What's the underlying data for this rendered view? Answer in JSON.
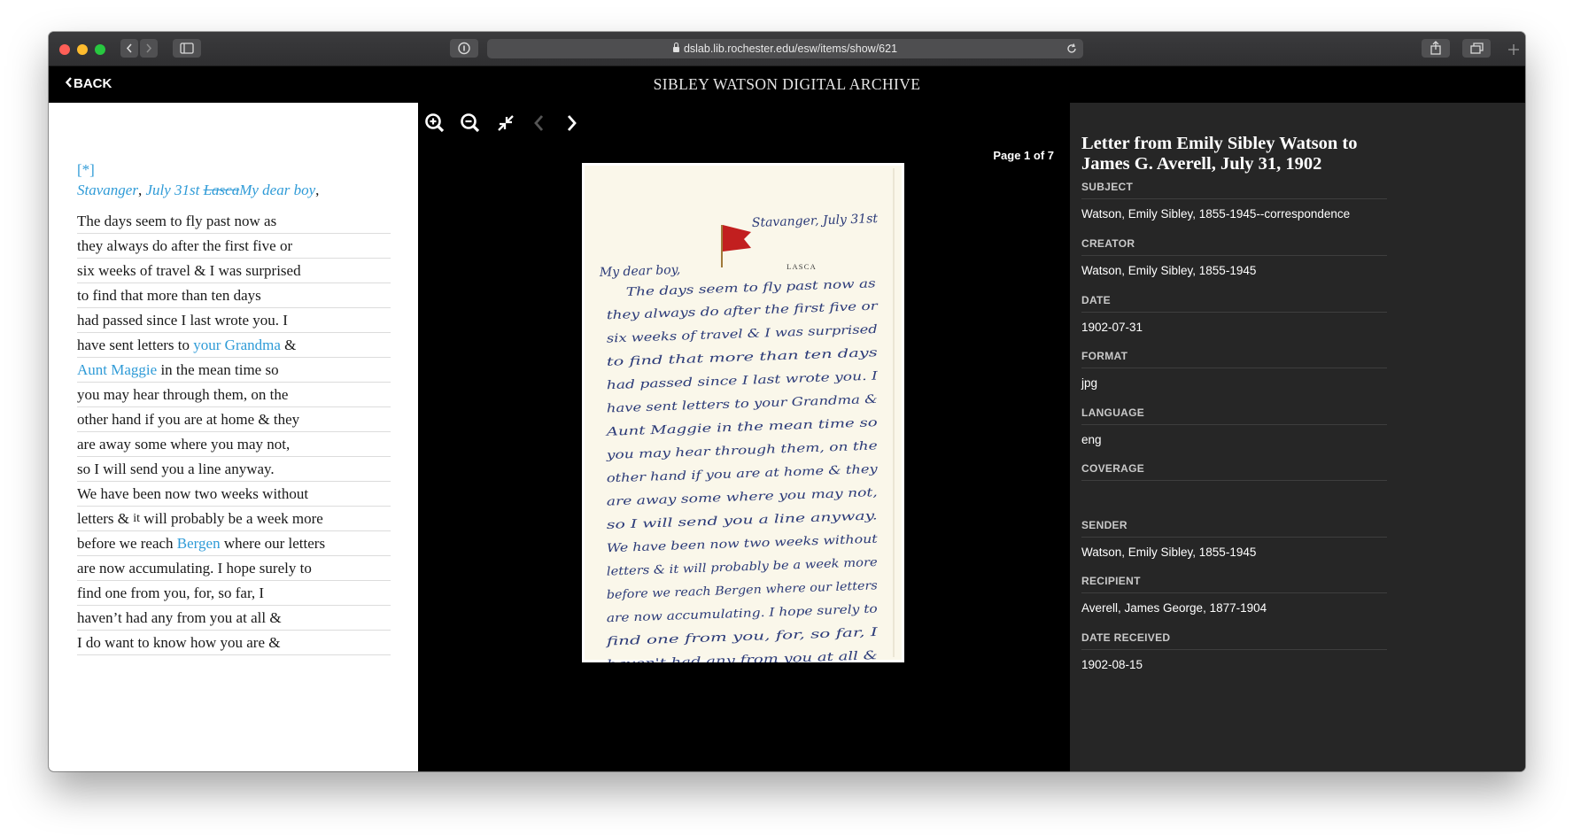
{
  "browser": {
    "url": "dslab.lib.rochester.edu/esw/items/show/621"
  },
  "header": {
    "back_label": "BACK",
    "site_title": "SIBLEY WATSON DIGITAL ARCHIVE"
  },
  "transcript": {
    "marker": "[*]",
    "place": "Stavanger",
    "date": "July 31st",
    "struck": "Lasca",
    "greeting": "My dear boy",
    "lines": [
      {
        "pre": "The days seem to fly past now as"
      },
      {
        "pre": "they always do after the first five or"
      },
      {
        "pre": "six weeks of travel & I was surprised"
      },
      {
        "pre": "to find that more than ten days"
      },
      {
        "pre": "had passed since I last wrote you. I"
      },
      {
        "pre": "have sent letters to ",
        "link": "your Grandma",
        "post": " &"
      },
      {
        "link": "Aunt Maggie",
        "post": " in the mean time so"
      },
      {
        "pre": "you may hear through them, on the"
      },
      {
        "pre": "other hand if you are at home & they"
      },
      {
        "pre": "are away some where you may not,"
      },
      {
        "pre": "so I will send you a line anyway."
      },
      {
        "pre": "We have been now two weeks without"
      },
      {
        "pre": "letters & ",
        "sup": "it",
        "post": " will probably be a week more"
      },
      {
        "pre": "before we reach ",
        "link": "Bergen",
        "post": " where our letters"
      },
      {
        "pre": "are now accumulating. I hope surely to"
      },
      {
        "pre": "find one from you, for, so far, I"
      },
      {
        "pre": "haven’t had any from you at all &"
      },
      {
        "pre": "I do want to know how you are &"
      }
    ]
  },
  "viewer": {
    "page_info": "Page 1 of 7",
    "letterhead": "LASCA",
    "handwriting": [
      "Stavanger, July 31st",
      "My dear boy,",
      "The days seem to fly past now as",
      "they always do after the first five or",
      "six weeks of travel & I was surprised",
      "to find that more than ten days",
      "had passed since I last wrote you. I",
      "have sent letters to your Grandma &",
      "Aunt Maggie in the mean time so",
      "you may hear through them, on the",
      "other hand if you are at home & they",
      "are away some where you may not,",
      "so I will send you a line anyway.",
      "We have been now two weeks without",
      "letters & it will probably be a week more",
      "before we reach Bergen where our letters",
      "are now accumulating. I hope surely to",
      "find one from you, for, so far, I",
      "haven't had any from you at all &",
      "I do want to know how you are &"
    ]
  },
  "metadata": {
    "title": "Letter from Emily Sibley Watson to James G. Averell, July 31, 1902",
    "fields": [
      {
        "label": "SUBJECT",
        "value": "Watson, Emily Sibley, 1855-1945--correspondence"
      },
      {
        "label": "CREATOR",
        "value": "Watson, Emily Sibley, 1855-1945"
      },
      {
        "label": "DATE",
        "value": "1902-07-31"
      },
      {
        "label": "FORMAT",
        "value": "jpg"
      },
      {
        "label": "LANGUAGE",
        "value": "eng"
      },
      {
        "label": "COVERAGE",
        "value": ""
      },
      {
        "label": "SENDER",
        "value": "Watson, Emily Sibley, 1855-1945"
      },
      {
        "label": "RECIPIENT",
        "value": "Averell, James George, 1877-1904"
      },
      {
        "label": "DATE RECEIVED",
        "value": "1902-08-15"
      }
    ]
  },
  "colors": {
    "link": "#2f9bd7",
    "metadata_bg": "#262626",
    "viewer_bg": "#000000",
    "flag": "#c21f1f",
    "ink": "#2b3a78"
  }
}
